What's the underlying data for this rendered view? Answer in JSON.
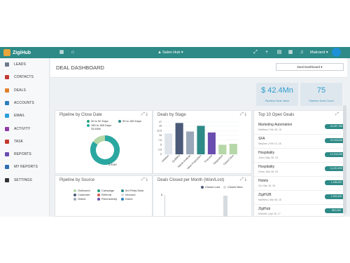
{
  "app": {
    "name": "ZigiHub",
    "hub_selector": "Sales Hub",
    "user_name": "Makrand"
  },
  "sidebar": {
    "items": [
      {
        "label": "LEADS",
        "icon": "leads-icon",
        "color": "#6d7a8a"
      },
      {
        "label": "CONTACTS",
        "icon": "contacts-icon",
        "color": "#c23b32"
      },
      {
        "label": "DEALS",
        "icon": "deals-icon",
        "color": "#e0802e"
      },
      {
        "label": "ACCOUNTS",
        "icon": "accounts-icon",
        "color": "#2a7fbf"
      },
      {
        "label": "EMAIL",
        "icon": "email-icon",
        "color": "#2a9fd6"
      },
      {
        "label": "ACTIVITY",
        "icon": "activity-icon",
        "color": "#8e3aa8"
      },
      {
        "label": "TASK",
        "icon": "task-icon",
        "color": "#c0392b"
      },
      {
        "label": "REPORTS",
        "icon": "reports-icon",
        "color": "#6a4db0"
      },
      {
        "label": "MY REPORTS",
        "icon": "my-reports-icon",
        "color": "#2c6fb3"
      },
      {
        "label": "SETTINGS",
        "icon": "settings-icon",
        "color": "#333333"
      }
    ]
  },
  "header": {
    "title": "DEAL DASHBOARD",
    "dashboard_select": "Deal Dashboard"
  },
  "kpis": [
    {
      "value": "$ 42.4Mn",
      "label": "Pipeline Deal Value"
    },
    {
      "value": "75",
      "label": "Pipeline Deal Count"
    }
  ],
  "pipeline_close_date": {
    "title": "Pipeline by Close Date",
    "legend": [
      {
        "label": "30 to 90 Days",
        "color": "#26a17f"
      },
      {
        "label": "90 to 180 Days",
        "color": "#2d8a87"
      },
      {
        "label": "180 to 365 Days",
        "color": "#2aa7a0"
      }
    ],
    "label_top": "33.936K",
    "label_bottom": "5.934K"
  },
  "deals_by_stage": {
    "title": "Deals by Stage",
    "y_ticks": [
      "17",
      "15",
      "12.5",
      "10",
      "7.5",
      "5",
      "2.5",
      "0"
    ]
  },
  "top_open_deals": {
    "title": "Top 10 Open Deals",
    "items": [
      {
        "name": "Marketing Automation",
        "meta": "Matthew | Feb 28, 18",
        "amount": "24,397,780"
      },
      {
        "name": "SFA",
        "meta": "Stephen | Feb 13, 18",
        "amount": "23,218,000"
      },
      {
        "name": "Hospitality",
        "meta": "John | May 28, 18",
        "amount": "12,104,000"
      },
      {
        "name": "Hospitality",
        "meta": "Chris | Mar 08, 18",
        "amount": "11,201,000"
      },
      {
        "name": "Hotels",
        "meta": "Gil | Mar 18, 18",
        "amount": "1,096,000"
      },
      {
        "name": "ZigiHUB",
        "meta": "Matthew | Mar 08, 18",
        "amount": "1,091,000"
      },
      {
        "name": "ZigiHub",
        "meta": "Michelle | Apr 26, 17",
        "amount": "851,000"
      }
    ]
  },
  "pipeline_by_source": {
    "title": "Pipeline by Source",
    "legend": [
      {
        "label": "Outbound",
        "color": "#b6d7a8"
      },
      {
        "label": "Campaign",
        "color": "#26a17f"
      },
      {
        "label": "3rd Party Data",
        "color": "#2d8a87"
      },
      {
        "label": "Customer",
        "color": "#4a5a78"
      },
      {
        "label": "Referral",
        "color": "#e05a4f"
      },
      {
        "label": "Inbound",
        "color": "#d6dbe0"
      },
      {
        "label": "Online",
        "color": "#9aa7b8"
      },
      {
        "label": "Field Activity",
        "color": "#6a4db0"
      },
      {
        "label": "Direct",
        "color": "#2a7fbf"
      }
    ]
  },
  "deals_closed_month": {
    "title": "Deals Closed per Month (Won/Lost)",
    "legend": [
      {
        "label": "Closed Lost",
        "color": "#4a5a78"
      },
      {
        "label": "Closed Won",
        "color": "#d6dbe0"
      }
    ],
    "y_tick": "8"
  },
  "chart_data": {
    "type": "bar",
    "title": "Deals by Stage",
    "categories": [
      "Initiation",
      "Qualified",
      "Needs Analysis",
      "Value Proposition",
      "Proposal",
      "Negotiation",
      "Closed Won"
    ],
    "values": [
      11,
      16.5,
      12,
      15,
      11.5,
      5,
      5.5
    ],
    "colors": [
      "#dfe3ea",
      "#4a5a78",
      "#9aa7b8",
      "#2d8a87",
      "#6a4db0",
      "#b6d7a8",
      "#b6d7a8"
    ],
    "ylim": [
      0,
      17
    ],
    "grid": true
  },
  "pie": {
    "values": [
      85,
      15
    ],
    "colors": [
      "#2aa7a0",
      "#b6d7a8"
    ]
  }
}
